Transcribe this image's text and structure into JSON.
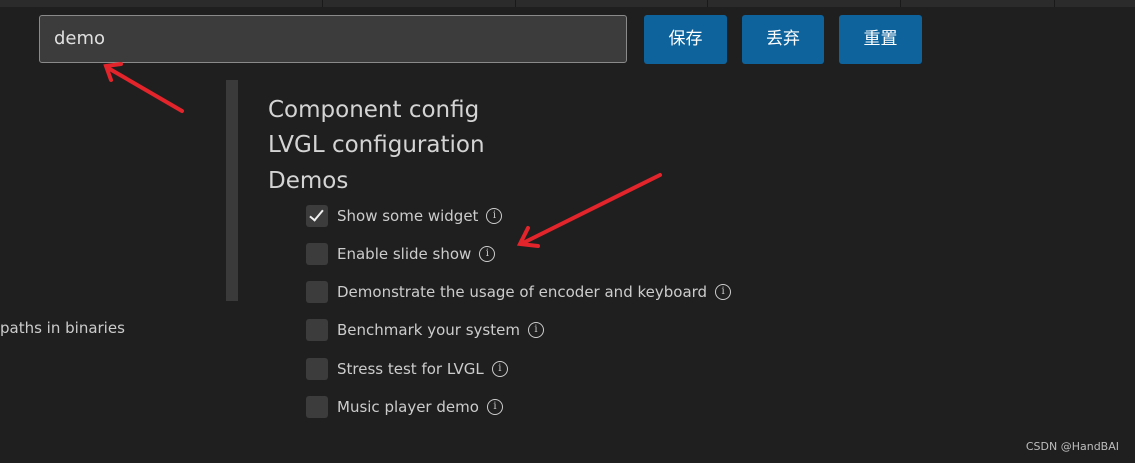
{
  "search": {
    "value": "demo"
  },
  "toolbar": {
    "save_label": "保存",
    "discard_label": "丢弃",
    "reset_label": "重置"
  },
  "tree": {
    "headings": [
      "Component config",
      "LVGL configuration",
      "Demos"
    ]
  },
  "options": [
    {
      "label": "Show some widget",
      "checked": true
    },
    {
      "label": "Enable slide show",
      "checked": false
    },
    {
      "label": "Demonstrate the usage of encoder and keyboard",
      "checked": false
    },
    {
      "label": "Benchmark your system",
      "checked": false
    },
    {
      "label": "Stress test for LVGL",
      "checked": false
    },
    {
      "label": "Music player demo",
      "checked": false
    }
  ],
  "sidebar": {
    "partial_text": "paths in binaries"
  },
  "watermark": "CSDN @HandBAI",
  "colors": {
    "background": "#1f1f1f",
    "button": "#0e639c",
    "annotation_arrow": "#e3242b"
  },
  "icons": {
    "info": "info-circle-icon",
    "check": "checkmark-icon"
  }
}
